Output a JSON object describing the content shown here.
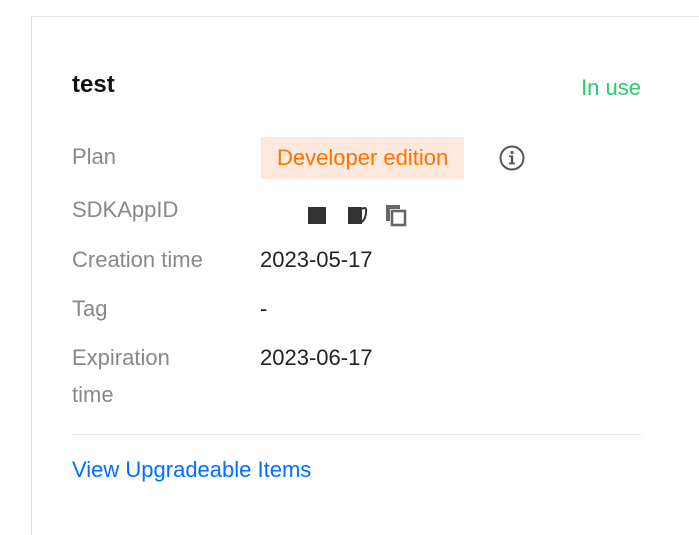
{
  "app": {
    "name": "test",
    "status": "In use",
    "status_color": "#29cc6a"
  },
  "details": {
    "plan_label": "Plan",
    "plan_value": "Developer edition",
    "sdkappid_label": "SDKAppID",
    "creation_label": "Creation time",
    "creation_value": "2023-05-17",
    "tag_label": "Tag",
    "tag_value": "-",
    "expiration_label_line1": "Expiration",
    "expiration_label_line2": "time",
    "expiration_value": "2023-06-17"
  },
  "icons": {
    "info": "info-icon",
    "copy": "copy-icon"
  },
  "actions": {
    "upgrade_link": "View Upgradeable Items"
  },
  "colors": {
    "accent_orange": "#ff7200",
    "badge_bg": "#ffe8dc",
    "link_blue": "#006eff"
  }
}
